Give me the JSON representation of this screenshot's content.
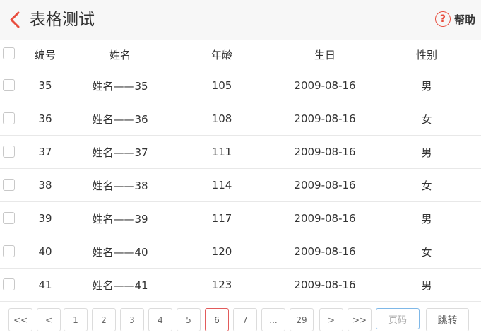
{
  "header": {
    "title": "表格测试",
    "help_label": "帮助",
    "help_icon_glyph": "?"
  },
  "table": {
    "columns": [
      "编号",
      "姓名",
      "年龄",
      "生日",
      "性别"
    ],
    "rows": [
      {
        "id": "35",
        "name": "姓名——35",
        "age": "105",
        "birthday": "2009-08-16",
        "sex": "男"
      },
      {
        "id": "36",
        "name": "姓名——36",
        "age": "108",
        "birthday": "2009-08-16",
        "sex": "女"
      },
      {
        "id": "37",
        "name": "姓名——37",
        "age": "111",
        "birthday": "2009-08-16",
        "sex": "男"
      },
      {
        "id": "38",
        "name": "姓名——38",
        "age": "114",
        "birthday": "2009-08-16",
        "sex": "女"
      },
      {
        "id": "39",
        "name": "姓名——39",
        "age": "117",
        "birthday": "2009-08-16",
        "sex": "男"
      },
      {
        "id": "40",
        "name": "姓名——40",
        "age": "120",
        "birthday": "2009-08-16",
        "sex": "女"
      },
      {
        "id": "41",
        "name": "姓名——41",
        "age": "123",
        "birthday": "2009-08-16",
        "sex": "男"
      }
    ]
  },
  "pager": {
    "first": "<<",
    "prev": "<",
    "pages": [
      "1",
      "2",
      "3",
      "4",
      "5",
      "6",
      "7",
      "...",
      "29"
    ],
    "next": ">",
    "last": ">>",
    "input_placeholder": "页码",
    "jump_label": "跳转",
    "current": "6"
  },
  "colors": {
    "accent": "#e84c3d",
    "active_page_border": "#e25b5b",
    "input_border": "#7fb8e8"
  },
  "icons": {
    "back": "chevron-left-icon",
    "help": "question-circle-icon"
  }
}
